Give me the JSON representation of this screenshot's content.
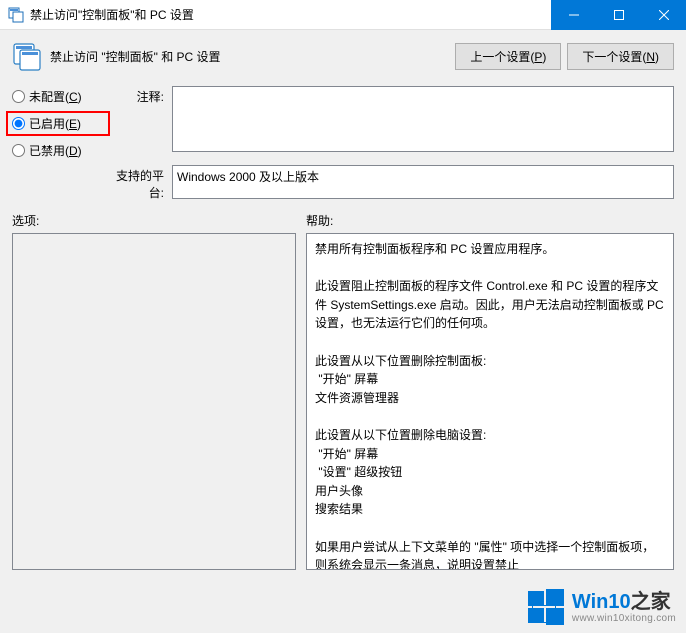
{
  "titlebar": {
    "title": "禁止访问\"控制面板\"和 PC 设置"
  },
  "header": {
    "policy_title": "禁止访问 \"控制面板\" 和 PC 设置",
    "prev_button": "上一个设置(P)",
    "next_button": "下一个设置(N)"
  },
  "radios": {
    "not_configured": "未配置(C)",
    "enabled": "已启用(E)",
    "disabled": "已禁用(D)",
    "selected": "enabled"
  },
  "labels": {
    "comment": "注释:",
    "platform": "支持的平台:",
    "options": "选项:",
    "help": "帮助:"
  },
  "fields": {
    "comment_value": "",
    "platform_value": "Windows 2000 及以上版本"
  },
  "help_text": "禁用所有控制面板程序和 PC 设置应用程序。\n\n此设置阻止控制面板的程序文件 Control.exe 和 PC 设置的程序文件 SystemSettings.exe 启动。因此，用户无法启动控制面板或 PC 设置，也无法运行它们的任何项。\n\n此设置从以下位置删除控制面板:\n \"开始\" 屏幕\n文件资源管理器\n\n此设置从以下位置删除电脑设置:\n \"开始\" 屏幕\n \"设置\" 超级按钮\n用户头像\n搜索结果\n\n如果用户尝试从上下文菜单的 \"属性\" 项中选择一个控制面板项，则系统会显示一条消息，说明设置禁止",
  "watermark": {
    "brand": "Win10",
    "suffix": "之家",
    "url": "www.win10xitong.com"
  }
}
